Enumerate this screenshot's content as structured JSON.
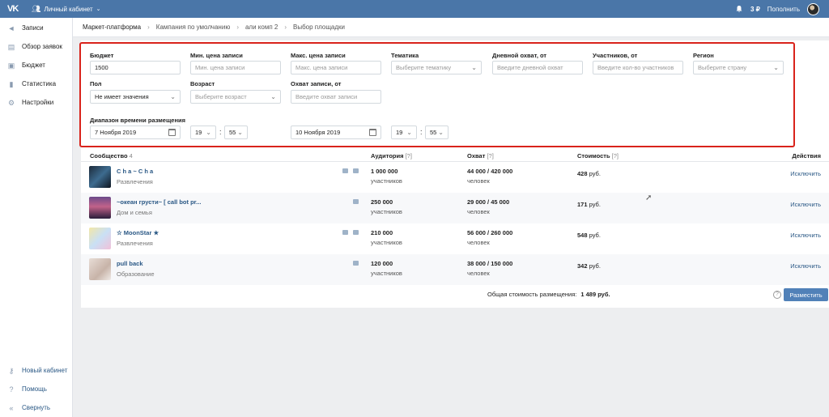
{
  "topbar": {
    "logo": "VK",
    "account_label": "Личный кабинет",
    "balance": "3 ₽",
    "topup_label": "Пополнить"
  },
  "sidebar": {
    "items": [
      {
        "label": "Записи",
        "icon": "megaphone-icon"
      },
      {
        "label": "Обзор заявок",
        "icon": "requests-icon"
      },
      {
        "label": "Бюджет",
        "icon": "wallet-icon"
      },
      {
        "label": "Статистика",
        "icon": "stats-icon"
      },
      {
        "label": "Настройки",
        "icon": "gear-icon"
      }
    ],
    "bottom_items": [
      {
        "label": "Новый кабинет",
        "icon": "key-icon"
      },
      {
        "label": "Помощь",
        "icon": "help-icon"
      },
      {
        "label": "Свернуть",
        "icon": "collapse-icon"
      }
    ]
  },
  "breadcrumb": [
    "Маркет-платформа",
    "Кампания по умолчанию",
    "али комп 2",
    "Выбор площадки"
  ],
  "filters": {
    "budget": {
      "label": "Бюджет",
      "value": "1500"
    },
    "min_price": {
      "label": "Мин. цена записи",
      "placeholder": "Мин. цена записи"
    },
    "max_price": {
      "label": "Макс. цена записи",
      "placeholder": "Макс. цена записи"
    },
    "topic": {
      "label": "Тематика",
      "placeholder": "Выберите тематику"
    },
    "daily_reach": {
      "label": "Дневной охват, от",
      "placeholder": "Введите дневной охват"
    },
    "members": {
      "label": "Участников, от",
      "placeholder": "Введите кол-во участников"
    },
    "region": {
      "label": "Регион",
      "placeholder": "Выберите страну"
    },
    "gender": {
      "label": "Пол",
      "value": "Не имеет значения"
    },
    "age": {
      "label": "Возраст",
      "placeholder": "Выберите возраст"
    },
    "post_reach": {
      "label": "Охват записи, от",
      "placeholder": "Введите охват записи"
    },
    "time_range": {
      "label": "Диапазон времени размещения",
      "start_date": "7 Ноября 2019",
      "start_hour": "19",
      "start_min": "55",
      "end_date": "10 Ноября 2019",
      "end_hour": "19",
      "end_min": "55"
    }
  },
  "table": {
    "headers": {
      "community": "Сообщество",
      "community_count": "4",
      "audience": "Аудитория",
      "reach": "Охват",
      "cost": "Стоимость",
      "actions": "Действия",
      "hint": "[?]"
    },
    "rows": [
      {
        "name": "C h a ~ C h a",
        "category": "Развлечения",
        "audience": "1 000 000",
        "audience_sub": "участников",
        "reach": "44 000 / 420 000",
        "reach_sub": "человек",
        "cost": "428",
        "currency": "руб.",
        "action": "Исключить"
      },
      {
        "name": "~океан грусти~ [ call bot pr...",
        "category": "Дом и семья",
        "audience": "250 000",
        "audience_sub": "участников",
        "reach": "29 000 / 45 000",
        "reach_sub": "человек",
        "cost": "171",
        "currency": "руб.",
        "action": "Исключить"
      },
      {
        "name": "☆ MoonStar ★",
        "category": "Развлечения",
        "audience": "210 000",
        "audience_sub": "участников",
        "reach": "56 000 / 260 000",
        "reach_sub": "человек",
        "cost": "548",
        "currency": "руб.",
        "action": "Исключить"
      },
      {
        "name": "pull back",
        "category": "Образование",
        "audience": "120 000",
        "audience_sub": "участников",
        "reach": "38 000 / 150 000",
        "reach_sub": "человек",
        "cost": "342",
        "currency": "руб.",
        "action": "Исключить"
      }
    ]
  },
  "footer": {
    "total_label": "Общая стоимость размещения:",
    "total_value": "1 489 руб.",
    "help_symbol": "?",
    "place_button": "Разместить"
  },
  "colors": {
    "topbar": "#4a76a8",
    "accent": "#5181b8",
    "highlight": "#d9231b",
    "link": "#2a5885"
  }
}
